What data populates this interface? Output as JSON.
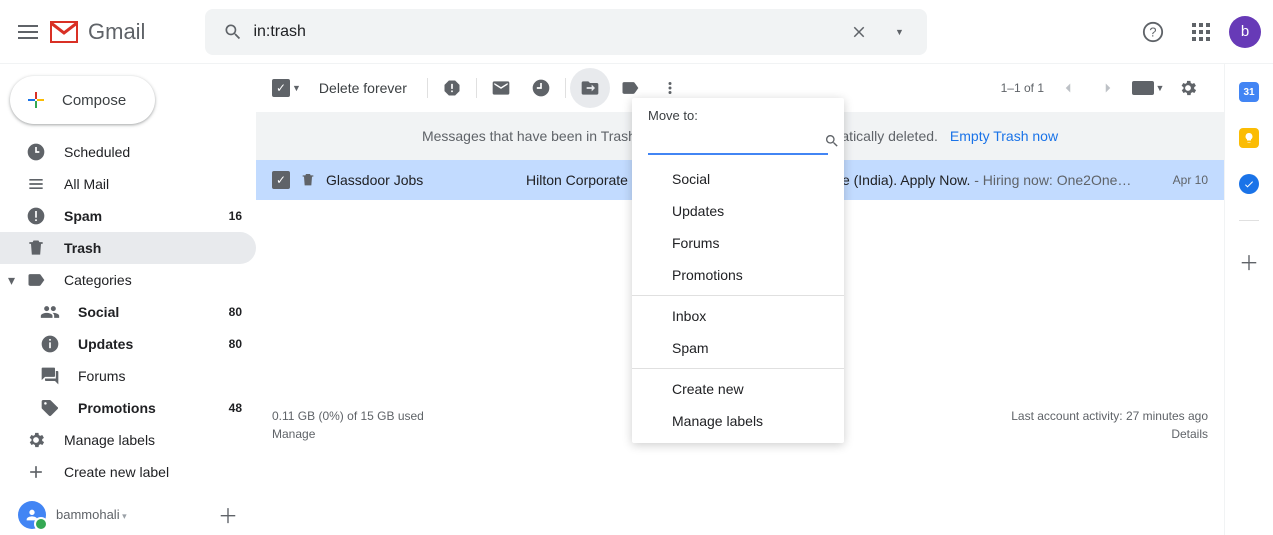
{
  "header": {
    "product": "Gmail",
    "search_value": "in:trash",
    "avatar_letter": "b"
  },
  "compose_label": "Compose",
  "sidebar": {
    "items": [
      {
        "label": "Scheduled",
        "count": "",
        "icon": "clock-send-icon"
      },
      {
        "label": "All Mail",
        "count": "",
        "icon": "stack-icon"
      },
      {
        "label": "Spam",
        "count": "16",
        "icon": "spam-icon",
        "bold": true
      },
      {
        "label": "Trash",
        "count": "",
        "icon": "trash-icon",
        "active": true,
        "bold": true
      },
      {
        "label": "Categories",
        "count": "",
        "icon": "label-icon",
        "expandable": true
      },
      {
        "label": "Social",
        "count": "80",
        "icon": "people-icon",
        "sub": true,
        "bold": true
      },
      {
        "label": "Updates",
        "count": "80",
        "icon": "info-icon",
        "sub": true,
        "bold": true
      },
      {
        "label": "Forums",
        "count": "",
        "icon": "forum-icon",
        "sub": true
      },
      {
        "label": "Promotions",
        "count": "48",
        "icon": "tag-icon",
        "sub": true,
        "bold": true
      },
      {
        "label": "Manage labels",
        "count": "",
        "icon": "gear-icon"
      },
      {
        "label": "Create new label",
        "count": "",
        "icon": "plus-icon"
      }
    ],
    "hangouts_user": "bammohali"
  },
  "toolbar": {
    "delete_forever": "Delete forever",
    "pager": "1–1 of 1"
  },
  "notice": {
    "text": "Messages that have been in Trash more than 30 days will be automatically deleted.",
    "action": "Empty Trash now"
  },
  "message": {
    "sender": "Glassdoor Jobs",
    "subject": "Hilton Corporate is hiring a Housekeeping Executive (India). Apply Now.",
    "preview": " - Hiring now: One2One…",
    "date": "Apr 10"
  },
  "moveto": {
    "title": "Move to:",
    "groups": [
      [
        "Social",
        "Updates",
        "Forums",
        "Promotions"
      ],
      [
        "Inbox",
        "Spam"
      ],
      [
        "Create new",
        "Manage labels"
      ]
    ]
  },
  "footer": {
    "storage_line": "0.11 GB (0%) of 15 GB used",
    "manage": "Manage",
    "activity": "Last account activity: 27 minutes ago",
    "details": "Details"
  },
  "rail": {
    "cal_day": "31"
  }
}
